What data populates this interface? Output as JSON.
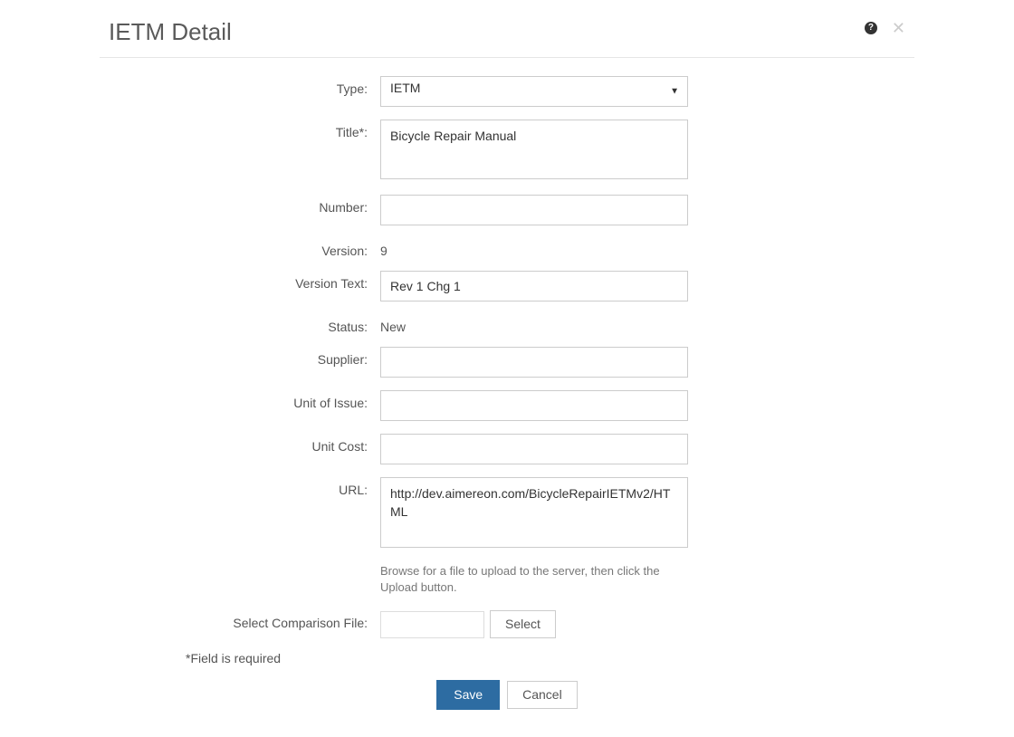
{
  "header": {
    "title": "IETM Detail"
  },
  "form": {
    "type": {
      "label": "Type:",
      "value": "IETM"
    },
    "title": {
      "label": "Title*:",
      "value": "Bicycle Repair Manual"
    },
    "number": {
      "label": "Number:",
      "value": ""
    },
    "version": {
      "label": "Version:",
      "value": "9"
    },
    "version_text": {
      "label": "Version Text:",
      "value": "Rev 1 Chg 1"
    },
    "status": {
      "label": "Status:",
      "value": "New"
    },
    "supplier": {
      "label": "Supplier:",
      "value": ""
    },
    "unit_of_issue": {
      "label": "Unit of Issue:",
      "value": ""
    },
    "unit_cost": {
      "label": "Unit Cost:",
      "value": ""
    },
    "url": {
      "label": "URL:",
      "value": "http://dev.aimereon.com/BicycleRepairIETMv2/HTML"
    },
    "file": {
      "hint": "Browse for a file to upload to the server, then click the Upload button.",
      "label": "Select Comparison File:",
      "select_label": "Select"
    }
  },
  "footer": {
    "required_note": "*Field is required",
    "save_label": "Save",
    "cancel_label": "Cancel"
  }
}
